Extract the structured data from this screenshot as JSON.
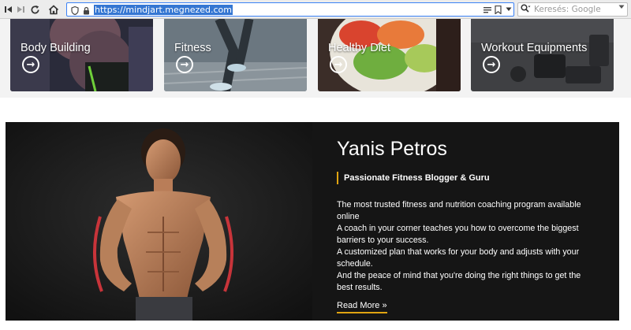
{
  "browser": {
    "url": "https://mindjart.megnezed.com",
    "search_placeholder": "Keresés: Google",
    "icons": {
      "back": "first-page-icon",
      "forward": "skip-forward-icon",
      "reload": "reload-icon",
      "home": "home-icon"
    }
  },
  "categories": [
    {
      "title": "Body Building"
    },
    {
      "title": "Fitness"
    },
    {
      "title": "Healthy Diet"
    },
    {
      "title": "Workout Equipments"
    }
  ],
  "profile": {
    "name": "Yanis Petros",
    "tagline": "Passionate Fitness Blogger & Guru",
    "description": [
      "The most trusted fitness and nutrition coaching program available online",
      "A coach in your corner teaches you how to overcome the biggest barriers to your success.",
      "A customized plan that works for your body and adjusts with your schedule.",
      "And the peace of mind that you're doing the right things to get the best results."
    ],
    "read_more": "Read More »"
  },
  "colors": {
    "accent": "#e0a411",
    "section_bg": "#151515",
    "url_highlight": "#3476d2"
  }
}
